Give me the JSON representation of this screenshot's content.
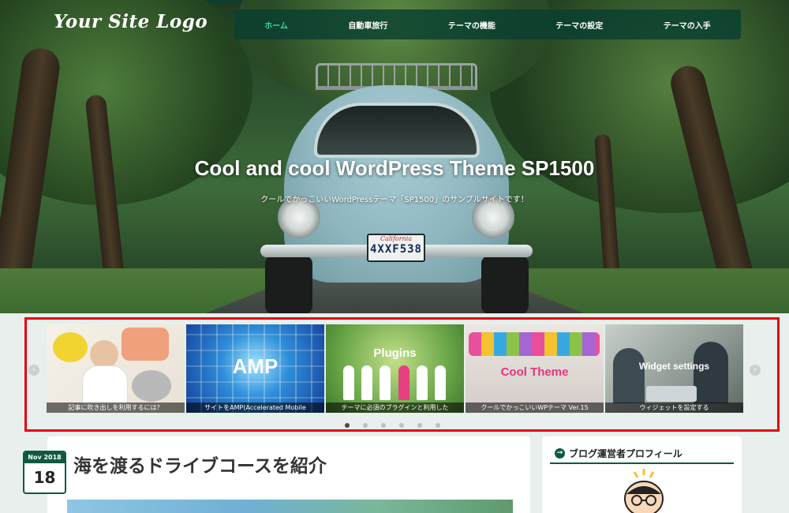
{
  "site": {
    "logo": "Your Site Logo"
  },
  "nav": [
    {
      "label": "ホーム",
      "active": true
    },
    {
      "label": "自動車旅行"
    },
    {
      "label": "テーマの機能"
    },
    {
      "label": "テーマの設定"
    },
    {
      "label": "テーマの入手"
    }
  ],
  "hero": {
    "title": "Cool and cool WordPress Theme SP1500",
    "subtitle": "クールでかっこいいWordPressテーマ「SP1500」のサンプルサイトです！",
    "plate_state": "California",
    "plate_number": "4XXF538"
  },
  "carousel": {
    "slides": [
      {
        "caption": "記事に吹き出しを利用するには？",
        "image_text": ""
      },
      {
        "caption": "サイトをAMP(Accelerated Mobile",
        "image_text": "AMP"
      },
      {
        "caption": "テーマに必須のプラグインと利用した",
        "image_text": "Plugins"
      },
      {
        "caption": "クールでかっこいいWPテーマ Ver.15",
        "image_text": "Cool Theme"
      },
      {
        "caption": "ウィジェットを設定する",
        "image_text": "Widget settings"
      }
    ],
    "dots": 6,
    "active_dot": 0,
    "prev_icon": "‹",
    "next_icon": "›"
  },
  "post": {
    "date_month": "Nov 2018",
    "date_day": "18",
    "title": "海を渡るドライブコースを紹介"
  },
  "sidebar": {
    "widget_title": "ブログ運営者プロフィール",
    "widget_icon": "→"
  },
  "colors": {
    "accent": "#0f5a3f",
    "nav_active": "#3dd6a3",
    "highlight_frame": "#e60012"
  }
}
